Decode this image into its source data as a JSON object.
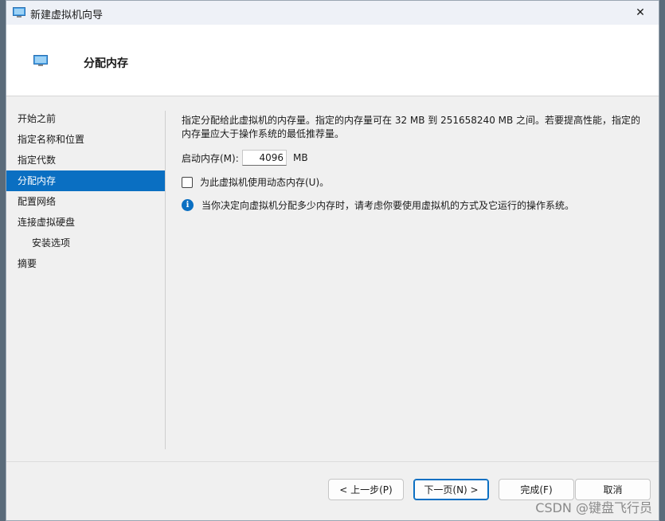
{
  "window": {
    "title": "新建虚拟机向导",
    "close_glyph": "✕"
  },
  "header": {
    "title": "分配内存",
    "icon": "monitor-icon"
  },
  "nav": {
    "items": [
      {
        "label": "开始之前",
        "active": false,
        "sub": false
      },
      {
        "label": "指定名称和位置",
        "active": false,
        "sub": false
      },
      {
        "label": "指定代数",
        "active": false,
        "sub": false
      },
      {
        "label": "分配内存",
        "active": true,
        "sub": false
      },
      {
        "label": "配置网络",
        "active": false,
        "sub": false
      },
      {
        "label": "连接虚拟硬盘",
        "active": false,
        "sub": false
      },
      {
        "label": "安装选项",
        "active": false,
        "sub": true
      },
      {
        "label": "摘要",
        "active": false,
        "sub": false
      }
    ]
  },
  "content": {
    "description": "指定分配给此虚拟机的内存量。指定的内存量可在 32 MB 到 251658240 MB 之间。若要提高性能，指定的内存量应大于操作系统的最低推荐量。",
    "startup_memory_label": "启动内存(M):",
    "startup_memory_value": "4096",
    "startup_memory_unit": "MB",
    "dynamic_memory_label": "为此虚拟机使用动态内存(U)。",
    "dynamic_memory_checked": false,
    "info_glyph": "i",
    "info_text": "当你决定向虚拟机分配多少内存时，请考虑你要使用虚拟机的方式及它运行的操作系统。"
  },
  "footer": {
    "prev_label": "< 上一步(P)",
    "next_label": "下一页(N) >",
    "finish_label": "完成(F)",
    "cancel_label": "取消"
  },
  "watermark": "CSDN @键盘飞行员",
  "colors": {
    "accent": "#0a6fc2",
    "window_bg": "#f0f0f0",
    "header_bg": "#ffffff"
  }
}
